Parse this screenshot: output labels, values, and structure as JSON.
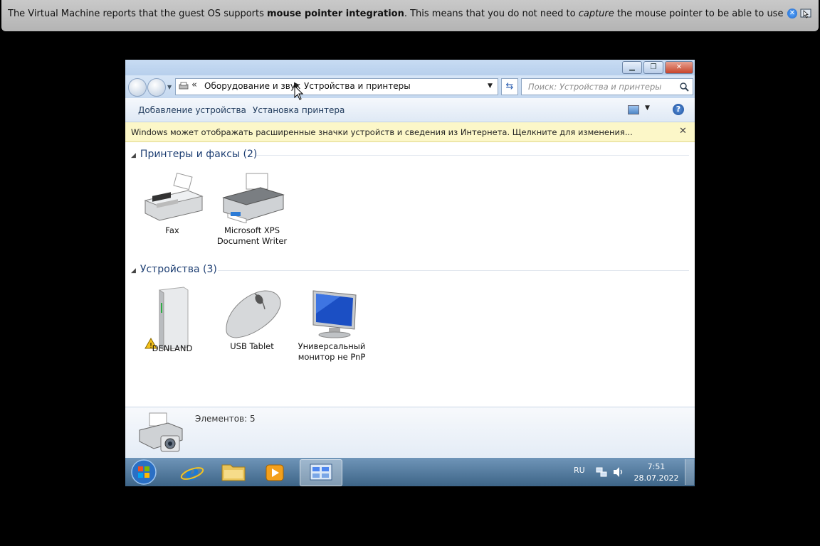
{
  "vbox_notice": {
    "part1": "The Virtual Machine reports that the guest OS supports ",
    "bold1": "mouse pointer integration",
    "part2": ". This means that you do not need to ",
    "italic1": "capture",
    "part3": " the mouse pointer to be able to use it in your guest OS --"
  },
  "window": {
    "address": {
      "crumb1": "Оборудование и звук",
      "crumb2": "Устройства и принтеры"
    },
    "search_placeholder": "Поиск: Устройства и принтеры",
    "toolbar": {
      "add_device": "Добавление устройства",
      "add_printer": "Установка принтера"
    },
    "infobar_text": "Windows может отображать расширенные значки устройств и сведения из Интернета.  Щелкните для изменения...",
    "groups": [
      {
        "title": "Принтеры и факсы (2)",
        "items": [
          {
            "line1": "Fax",
            "line2": ""
          },
          {
            "line1": "Microsoft XPS",
            "line2": "Document Writer"
          }
        ]
      },
      {
        "title": "Устройства (3)",
        "items": [
          {
            "line1": "DENLAND",
            "line2": ""
          },
          {
            "line1": "USB Tablet",
            "line2": ""
          },
          {
            "line1": "Универсальный",
            "line2": "монитор не PnP"
          }
        ]
      }
    ],
    "details_count": "Элементов: 5"
  },
  "taskbar": {
    "language": "RU",
    "time": "7:51",
    "date": "28.07.2022"
  },
  "colors": {
    "taskbar": "#3d6487",
    "infobar": "#fcf7c8",
    "group_heading": "#1e3f73"
  }
}
